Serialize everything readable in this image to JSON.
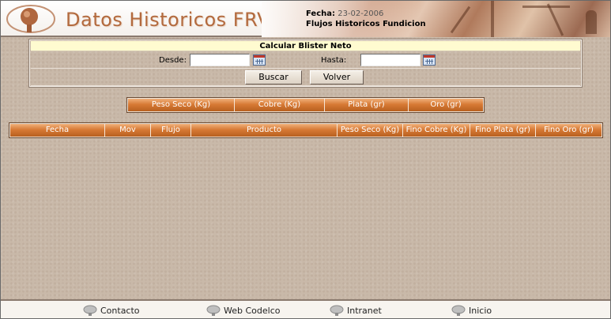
{
  "header": {
    "title": "Datos Historicos FRV",
    "fecha_label": "Fecha:",
    "fecha_value": "23-02-2006",
    "subtitle": "Flujos Historicos Fundicion"
  },
  "form": {
    "title": "Calcular Blister Neto",
    "desde_label": "Desde:",
    "desde_value": "",
    "hasta_label": "Hasta:",
    "hasta_value": "",
    "buscar_label": "Buscar",
    "volver_label": "Volver"
  },
  "summary": {
    "columns": [
      "Peso Seco (Kg)",
      "Cobre (Kg)",
      "Plata (gr)",
      "Oro (gr)"
    ]
  },
  "detail": {
    "columns": [
      "Fecha",
      "Mov",
      "Flujo",
      "Producto",
      "Peso Seco (Kg)",
      "Fino Cobre (Kg)",
      "Fino Plata (gr)",
      "Fino Oro (gr)"
    ]
  },
  "footer": {
    "links": [
      "Contacto",
      "Web Codelco",
      "Intranet",
      "Inicio"
    ]
  },
  "colors": {
    "accent": "#d77a35",
    "title": "#b36a3e",
    "panel_title_bg": "#fffbd0"
  }
}
